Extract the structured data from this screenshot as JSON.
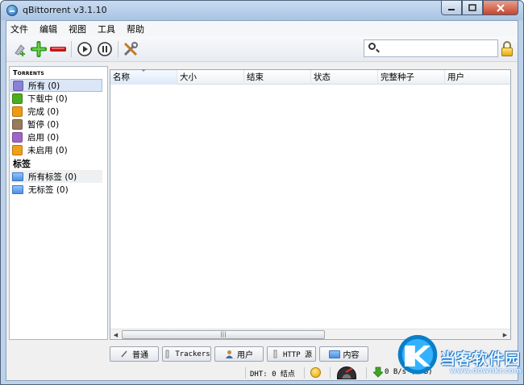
{
  "window": {
    "title": "qBittorrent v3.1.10"
  },
  "menu": [
    "文件",
    "编辑",
    "视图",
    "工具",
    "帮助"
  ],
  "toolbar": {
    "icons": [
      "add-torrent-link-icon",
      "add-torrent-icon",
      "remove-icon",
      "resume-icon",
      "pause-icon",
      "options-icon"
    ],
    "search_value": "",
    "lock_icon": "lock-icon"
  },
  "sidebar": {
    "status_header": "Torrents",
    "status_items": [
      {
        "label": "所有 (0)",
        "icon": "all-icon",
        "color": "#8a7fd9"
      },
      {
        "label": "下载中 (0)",
        "icon": "downloading-icon",
        "color": "#4cae1d"
      },
      {
        "label": "完成 (0)",
        "icon": "completed-icon",
        "color": "#f09a12"
      },
      {
        "label": "暂停 (0)",
        "icon": "paused-icon",
        "color": "#9a7a5a"
      },
      {
        "label": "启用 (0)",
        "icon": "active-icon",
        "color": "#a064c8"
      },
      {
        "label": "未启用 (0)",
        "icon": "inactive-icon",
        "color": "#f0a018"
      }
    ],
    "labels_header": "标签",
    "label_items": [
      {
        "label": "所有标签 (0)"
      },
      {
        "label": "无标签 (0)"
      }
    ]
  },
  "table": {
    "columns": [
      "名称",
      "大小",
      "结束",
      "状态",
      "完整种子",
      "用户"
    ],
    "rows": []
  },
  "tabs": [
    {
      "label": "普通",
      "icon": "general-icon"
    },
    {
      "label": "Trackers",
      "icon": "trackers-icon"
    },
    {
      "label": "用户",
      "icon": "peers-icon"
    },
    {
      "label": "HTTP 源",
      "icon": "http-sources-icon"
    },
    {
      "label": "内容",
      "icon": "content-icon"
    }
  ],
  "status": {
    "dht": "DHT: 0 结点",
    "download": "0 B/s (0 B)"
  },
  "watermark": {
    "text": "当客软件园",
    "url": "www.downkr.com"
  }
}
